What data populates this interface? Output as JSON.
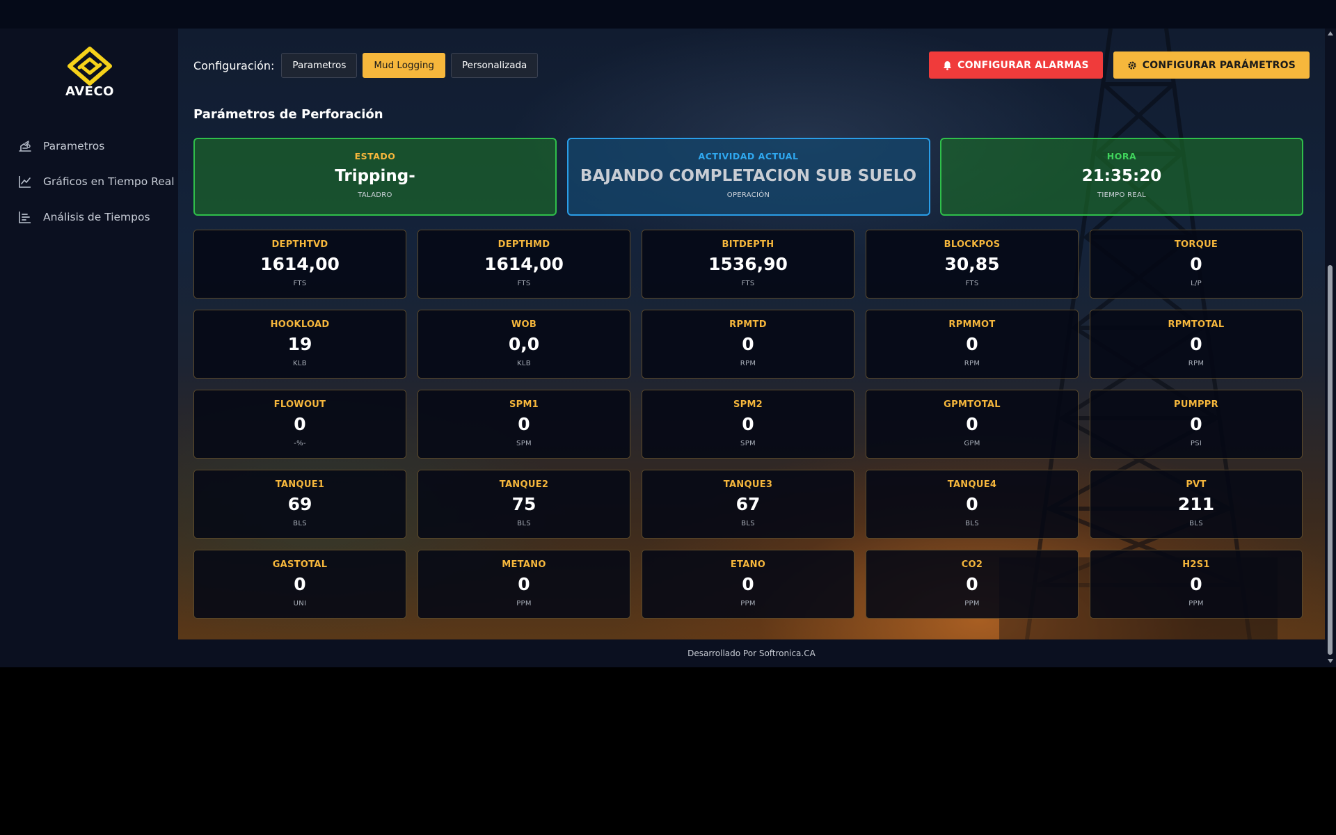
{
  "brand": {
    "name": "AVECO"
  },
  "sidebar": {
    "items": [
      {
        "label": "Parametros",
        "icon": "drill-rig-icon"
      },
      {
        "label": "Gráficos en Tiempo Real",
        "icon": "line-chart-icon"
      },
      {
        "label": "Análisis de Tiempos",
        "icon": "bar-chart-icon"
      }
    ]
  },
  "toolbar": {
    "config_label": "Configuración:",
    "tabs": [
      {
        "label": "Parametros",
        "active": false
      },
      {
        "label": "Mud Logging",
        "active": true
      },
      {
        "label": "Personalizada",
        "active": false
      }
    ],
    "alarm_button": "CONFIGURAR ALARMAS",
    "params_button": "CONFIGURAR PARÁMETROS"
  },
  "section_title": "Parámetros de Perforación",
  "status": [
    {
      "label": "ESTADO",
      "value": "Tripping-",
      "sub": "TALADRO"
    },
    {
      "label": "ACTIVIDAD ACTUAL",
      "value": "BAJANDO COMPLETACION SUB SUELO",
      "sub": "OPERACIÓN"
    },
    {
      "label": "HORA",
      "value": "21:35:20",
      "sub": "TIEMPO REAL"
    }
  ],
  "params": [
    {
      "name": "DEPTHTVD",
      "value": "1614,00",
      "unit": "FTS"
    },
    {
      "name": "DEPTHMD",
      "value": "1614,00",
      "unit": "FTS"
    },
    {
      "name": "BITDEPTH",
      "value": "1536,90",
      "unit": "FTS"
    },
    {
      "name": "BLOCKPOS",
      "value": "30,85",
      "unit": "FTS"
    },
    {
      "name": "TORQUE",
      "value": "0",
      "unit": "L/P"
    },
    {
      "name": "HOOKLOAD",
      "value": "19",
      "unit": "KLB"
    },
    {
      "name": "WOB",
      "value": "0,0",
      "unit": "KLB"
    },
    {
      "name": "RPMTD",
      "value": "0",
      "unit": "RPM"
    },
    {
      "name": "RPMMOT",
      "value": "0",
      "unit": "RPM"
    },
    {
      "name": "RPMTOTAL",
      "value": "0",
      "unit": "RPM"
    },
    {
      "name": "FLOWOUT",
      "value": "0",
      "unit": "-%-"
    },
    {
      "name": "SPM1",
      "value": "0",
      "unit": "SPM"
    },
    {
      "name": "SPM2",
      "value": "0",
      "unit": "SPM"
    },
    {
      "name": "GPMTOTAL",
      "value": "0",
      "unit": "GPM"
    },
    {
      "name": "PUMPPR",
      "value": "0",
      "unit": "PSI"
    },
    {
      "name": "TANQUE1",
      "value": "69",
      "unit": "BLS"
    },
    {
      "name": "TANQUE2",
      "value": "75",
      "unit": "BLS"
    },
    {
      "name": "TANQUE3",
      "value": "67",
      "unit": "BLS"
    },
    {
      "name": "TANQUE4",
      "value": "0",
      "unit": "BLS"
    },
    {
      "name": "PVT",
      "value": "211",
      "unit": "BLS"
    },
    {
      "name": "GASTOTAL",
      "value": "0",
      "unit": "UNI"
    },
    {
      "name": "METANO",
      "value": "0",
      "unit": "PPM"
    },
    {
      "name": "ETANO",
      "value": "0",
      "unit": "PPM"
    },
    {
      "name": "CO2",
      "value": "0",
      "unit": "PPM"
    },
    {
      "name": "H2S1",
      "value": "0",
      "unit": "PPM"
    }
  ],
  "footer": {
    "text": "Desarrollado Por Softronica.CA"
  },
  "colors": {
    "accent": "#f6b73c",
    "danger": "#f03b3b",
    "success": "#2fbf4a",
    "info": "#2a9ee8"
  }
}
